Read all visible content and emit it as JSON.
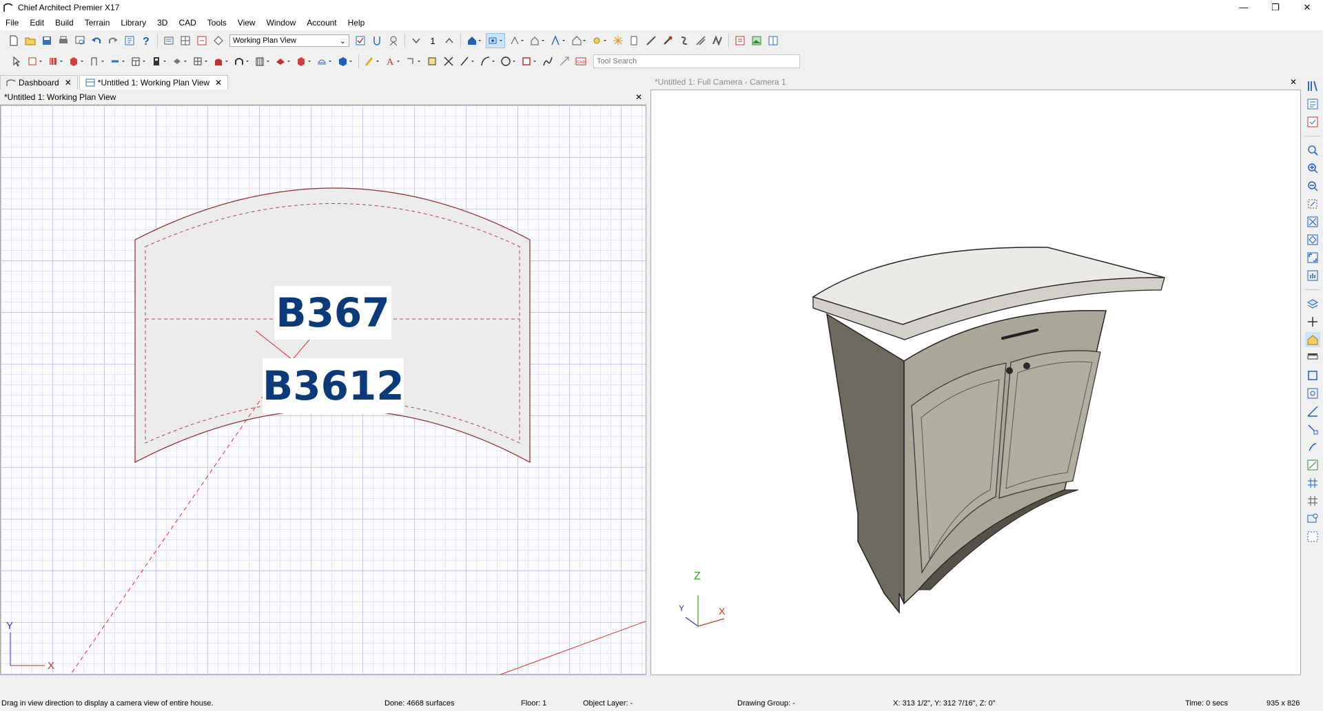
{
  "window": {
    "title": "Chief Architect Premier X17"
  },
  "menu": [
    "File",
    "Edit",
    "Build",
    "Terrain",
    "Library",
    "3D",
    "CAD",
    "Tools",
    "View",
    "Window",
    "Account",
    "Help"
  ],
  "toolbar": {
    "view_select": "Working Plan View",
    "floor_number": "1",
    "tool_search_placeholder": "Tool Search"
  },
  "tabs": [
    {
      "label": "Dashboard"
    },
    {
      "label": "*Untitled 1:  Working Plan View"
    }
  ],
  "plan": {
    "header": "*Untitled 1:  Working Plan View",
    "labels": [
      "B367",
      "B3612"
    ],
    "axis": {
      "y": "Y",
      "x": "X"
    }
  },
  "camera": {
    "header": "*Untitled 1: Full Camera - Camera 1",
    "axis": {
      "z": "Z",
      "y": "Y",
      "x": "X"
    }
  },
  "status": {
    "hint": "Drag in view direction to display a camera view of entire house.",
    "done": "Done:  4668 surfaces",
    "floor": "Floor: 1",
    "layer": "Object Layer: -",
    "group": "Drawing Group: -",
    "coords": "X: 313 1/2\", Y: 312 7/16\", Z: 0\"",
    "time": "Time: 0 secs",
    "size": "935 x 826"
  },
  "colors": {
    "plan_line": "#8b2c2c",
    "label_text": "#0a3a7a",
    "cabinet": "#a9a496",
    "countertop": "#ececea"
  }
}
